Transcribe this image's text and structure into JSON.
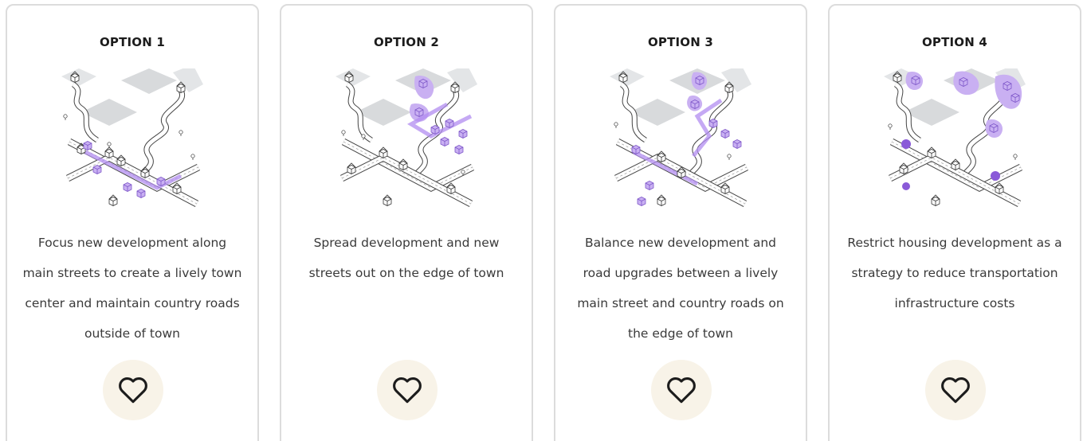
{
  "options": [
    {
      "title": "OPTION 1",
      "description": "Focus new development along main streets to create a lively town center and maintain country roads outside of town",
      "illustration_icon": "town-map-main-street-icon"
    },
    {
      "title": "OPTION 2",
      "description": "Spread development and new streets out on the edge of town",
      "illustration_icon": "town-map-edge-development-icon"
    },
    {
      "title": "OPTION 3",
      "description": "Balance new development and road upgrades between a lively main street and country roads on the edge of town",
      "illustration_icon": "town-map-balanced-icon"
    },
    {
      "title": "OPTION 4",
      "description": "Restrict housing development as a strategy to reduce transportation infrastructure costs",
      "illustration_icon": "town-map-restricted-icon"
    }
  ],
  "vote_icon": "heart-icon",
  "colors": {
    "accent_purple": "#a985e6",
    "button_bg": "#f8f3e8",
    "card_border": "#dcdcdc",
    "text": "#1c1c1c"
  }
}
